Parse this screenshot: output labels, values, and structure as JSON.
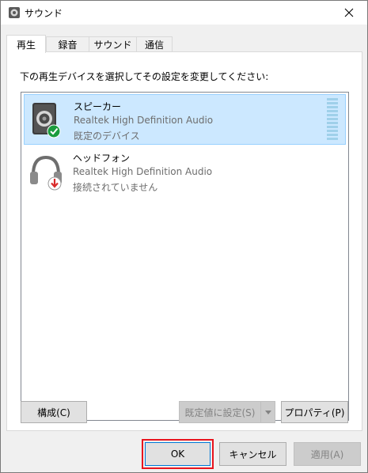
{
  "window": {
    "title": "サウンド",
    "title_icon": "speaker-icon",
    "close_icon": "close-icon"
  },
  "tabs": [
    {
      "label": "再生",
      "active": true
    },
    {
      "label": "録音",
      "active": false
    },
    {
      "label": "サウンド",
      "active": false
    },
    {
      "label": "通信",
      "active": false
    }
  ],
  "instruction": "下の再生デバイスを選択してその設定を変更してください:",
  "devices": [
    {
      "name": "スピーカー",
      "driver": "Realtek High Definition Audio",
      "status": "既定のデバイス",
      "icon": "speaker-device-icon",
      "badge": "default-check-icon",
      "selected": true
    },
    {
      "name": "ヘッドフォン",
      "driver": "Realtek High Definition Audio",
      "status": "接続されていません",
      "icon": "headphones-device-icon",
      "badge": "unplugged-arrow-icon",
      "selected": false
    }
  ],
  "buttons": {
    "configure": "構成(C)",
    "set_default": "既定値に設定(S)",
    "properties": "プロパティ(P)",
    "ok": "OK",
    "cancel": "キャンセル",
    "apply": "適用(A)"
  },
  "colors": {
    "selection_bg": "#cce8ff",
    "selection_border": "#99d1ff",
    "check_badge": "#1a9c3e",
    "unplugged_badge": "#d92b2b",
    "highlight_box": "#e8141e"
  }
}
